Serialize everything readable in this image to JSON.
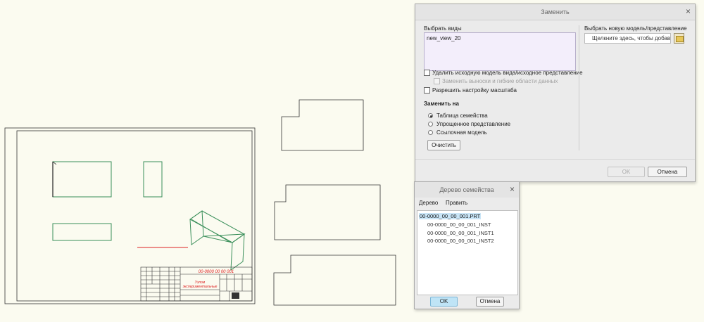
{
  "replace_dialog": {
    "title": "Заменить",
    "select_views_label": "Выбрать виды",
    "selected_view": "new_view_20",
    "delete_original_label": "Удалить исходную модель вида/исходное представление",
    "replace_callouts_label": "Заменить выноски и гибкие области данных",
    "allow_scale_label": "Разрешить настройку масштаба",
    "replace_with_label": "Заменить на",
    "options": [
      "Таблица семейства",
      "Упрощенное представление",
      "Ссылочная модель"
    ],
    "selected_option": "Таблица семейства",
    "clear_button": "Очистить",
    "new_model_label": "Выбрать новую модель/представление",
    "new_model_field": "Щелкните здесь, чтобы добавить",
    "ok_button": "OK",
    "cancel_button": "Отмена"
  },
  "family_tree_dialog": {
    "title": "Дерево семейства",
    "menu": [
      "Дерево",
      "Править"
    ],
    "root": "00-0000_00_00_001.PRT",
    "children": [
      "00-0000_00_00_001_INST",
      "00-0000_00_00_001_INST1",
      "00-0000_00_00_001_INST2"
    ],
    "ok_button": "OK",
    "cancel_button": "Отмена"
  },
  "drawing": {
    "title_block_number": "00-0000 00 00 001",
    "title_block_name_1": "Узлом",
    "title_block_name_2": "экспериментальные"
  },
  "colors": {
    "accent_selection": "#c9e5f7",
    "drawing_red": "#dd2222",
    "part_green": "#3a8f5a"
  }
}
